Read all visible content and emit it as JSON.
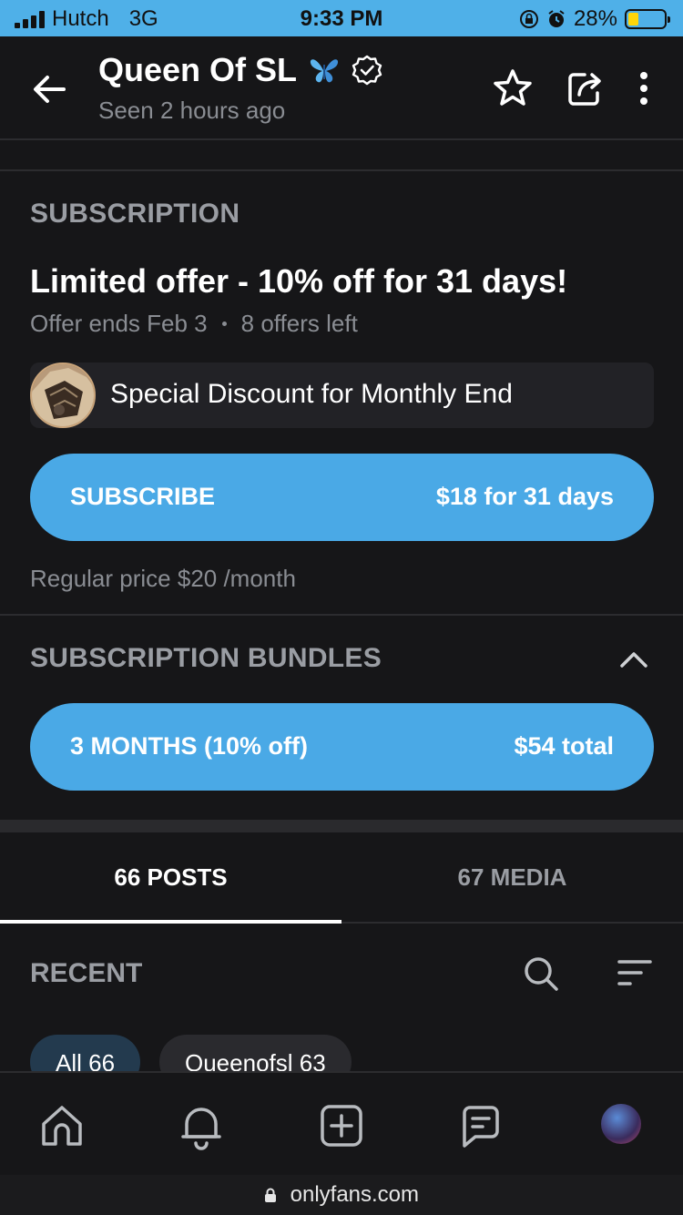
{
  "status_bar": {
    "carrier": "Hutch",
    "network": "3G",
    "time": "9:33 PM",
    "battery": "28%",
    "battery_level": 0.28
  },
  "header": {
    "title": "Queen Of SL",
    "seen": "Seen 2 hours ago",
    "icons": [
      "back-arrow-icon",
      "butterfly-icon",
      "verified-icon",
      "star-icon",
      "share-icon",
      "more-icon"
    ]
  },
  "subscription": {
    "section_label": "SUBSCRIPTION",
    "offer_title": "Limited offer - 10% off for 31 days!",
    "offer_ends": "Offer ends Feb 3",
    "offers_left": "8 offers left",
    "promo_text": "Special Discount for Monthly End",
    "subscribe_label": "SUBSCRIBE",
    "subscribe_price": "$18 for 31 days",
    "regular_price": "Regular price $20 /month"
  },
  "bundles": {
    "section_label": "SUBSCRIPTION BUNDLES",
    "items": [
      {
        "label": "3 MONTHS (10% off)",
        "price": "$54 total"
      }
    ]
  },
  "tabs": [
    {
      "label": "66 POSTS",
      "active": true
    },
    {
      "label": "67 MEDIA",
      "active": false
    }
  ],
  "recent": {
    "label": "RECENT",
    "chips": [
      {
        "label": "All 66",
        "active": true
      },
      {
        "label": "Queenofsl 63",
        "active": false
      }
    ]
  },
  "bottom_nav": [
    "home-icon",
    "bell-icon",
    "add-post-icon",
    "messages-icon",
    "profile-avatar"
  ],
  "url_bar": {
    "url": "onlyfans.com"
  },
  "colors": {
    "accent": "#4aa9e6",
    "background": "#161618",
    "status_bar": "#4fb0e8"
  }
}
